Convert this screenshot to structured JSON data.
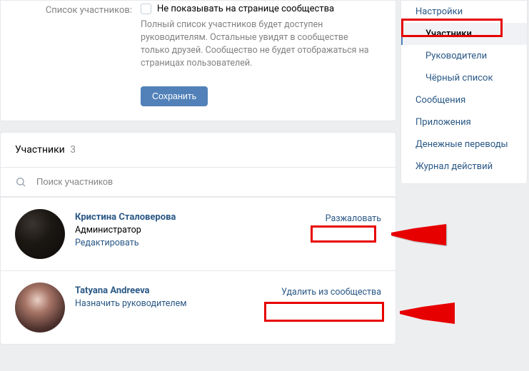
{
  "settings": {
    "row_label": "Список участников:",
    "checkbox_label": "Не показывать на странице сообщества",
    "hint": "Полный список участников будет доступен руководителям. Остальные увидят в сообществе только друзей. Сообщество не будет отображаться на страницах пользователей.",
    "save_label": "Сохранить"
  },
  "members_header": {
    "title": "Участники",
    "count": "3"
  },
  "search": {
    "placeholder": "Поиск участников"
  },
  "members": [
    {
      "name": "Кристина Сталоверова",
      "role": "Администратор",
      "edit": "Редактировать",
      "action": "Разжаловать"
    },
    {
      "name": "Tatyana Andreeva",
      "assign": "Назначить руководителем",
      "action": "Удалить из сообщества"
    }
  ],
  "sidebar": {
    "settings": "Настройки",
    "members": "Участники",
    "managers": "Руководители",
    "blacklist": "Чёрный список",
    "messages": "Сообщения",
    "apps": "Приложения",
    "transfers": "Денежные переводы",
    "log": "Журнал действий"
  }
}
